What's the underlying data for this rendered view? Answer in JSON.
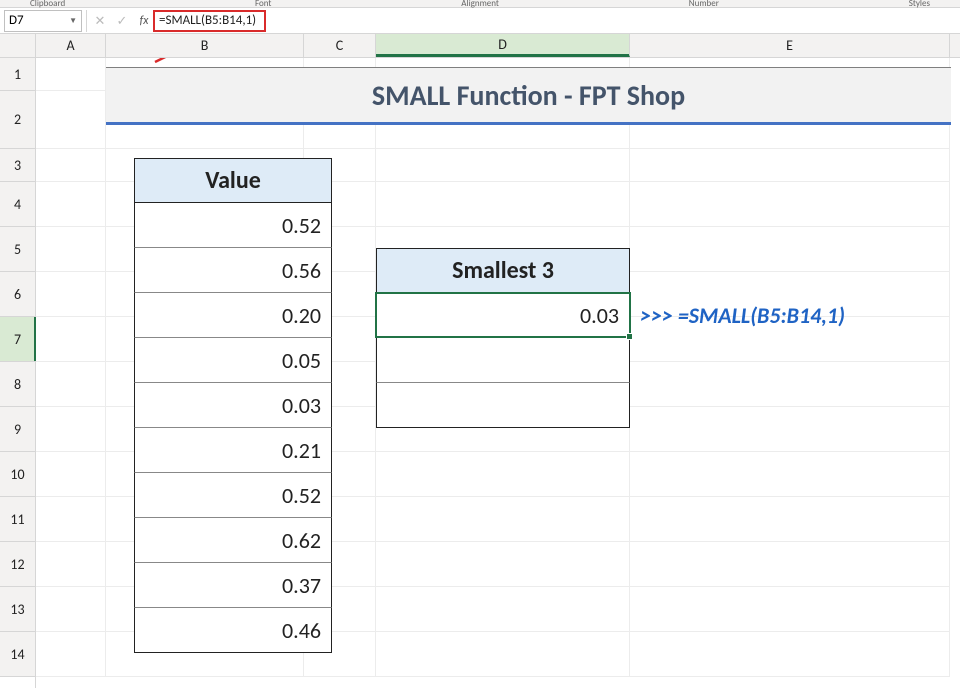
{
  "ribbon": {
    "labels": [
      "Clipboard",
      "Font",
      "Alignment",
      "Number",
      "Styles"
    ]
  },
  "nameBox": "D7",
  "formulaBar": "=SMALL(B5:B14,1)",
  "columns": [
    "A",
    "B",
    "C",
    "D",
    "E"
  ],
  "rowNumbers": [
    "1",
    "2",
    "3",
    "4",
    "5",
    "6",
    "7",
    "8",
    "9",
    "10",
    "11",
    "12",
    "13",
    "14"
  ],
  "title": "SMALL Function - FPT Shop",
  "valueTable": {
    "header": "Value",
    "rows": [
      "0.52",
      "0.56",
      "0.20",
      "0.05",
      "0.03",
      "0.21",
      "0.52",
      "0.62",
      "0.37",
      "0.46"
    ]
  },
  "smallTable": {
    "header": "Smallest 3",
    "rows": [
      "0.03",
      "",
      ""
    ]
  },
  "annotation": ">>> =SMALL(B5:B14,1)",
  "selectedCell": {
    "col": "D",
    "row": 7
  }
}
